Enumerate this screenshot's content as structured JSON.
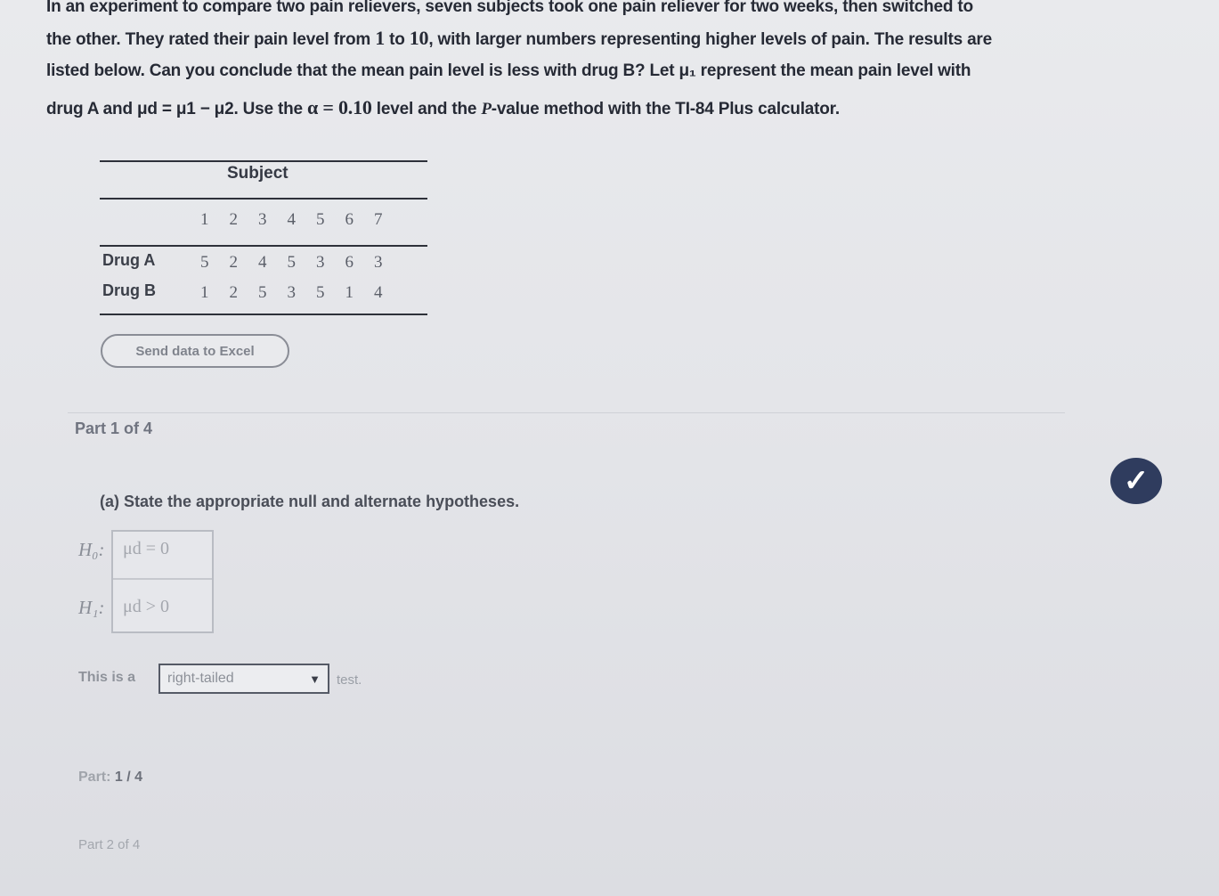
{
  "problem": {
    "line1": "In an experiment to compare two pain relievers, seven subjects took one pain reliever for two weeks, then switched to",
    "line2a": "the other. They rated their pain level from",
    "num_one": "1",
    "line2b": "to",
    "num_ten": "10",
    "line2c": ", with larger numbers representing higher levels of pain. The results are",
    "line3": "listed below. Can you conclude that the mean pain level is less with drug B? Let μ₁ represent the mean pain level with",
    "line4a": "drug A and μd = μ1 − μ2. Use the",
    "alpha": "α = 0.10",
    "line4b": "level and the",
    "pvalue": "P",
    "line4c": "-value method with the TI-84 Plus calculator."
  },
  "table": {
    "header": "Subject",
    "subjects": [
      "1",
      "2",
      "3",
      "4",
      "5",
      "6",
      "7"
    ],
    "rows": [
      {
        "label": "Drug A",
        "values": [
          "5",
          "2",
          "4",
          "5",
          "3",
          "6",
          "3"
        ]
      },
      {
        "label": "Drug B",
        "values": [
          "1",
          "2",
          "5",
          "3",
          "5",
          "1",
          "4"
        ]
      }
    ]
  },
  "excel_button": "Send data to Excel",
  "part_title": "Part 1 of 4",
  "question": "(a) State the appropriate null and alternate hypotheses.",
  "hypotheses": {
    "h0_label": "H₀:",
    "h0_expr": "μd = 0",
    "h1_label": "H₁:",
    "h1_expr": "μd > 0"
  },
  "tail": {
    "prefix": "This is a",
    "selected": "right-tailed",
    "suffix": "test."
  },
  "part_nav": {
    "label": "Part:",
    "current": "1 / 4"
  },
  "next_part": "Part 2 of 4"
}
